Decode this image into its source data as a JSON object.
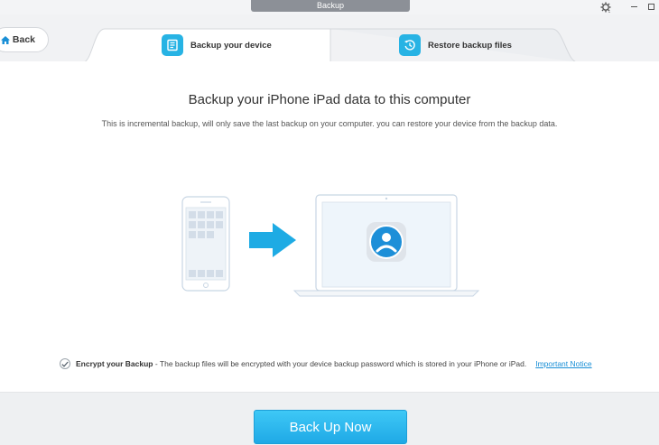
{
  "window": {
    "title": "Backup"
  },
  "nav": {
    "back_label": "Back"
  },
  "tabs": [
    {
      "label": "Backup your device",
      "active": true,
      "icon": "backup-doc-icon"
    },
    {
      "label": "Restore backup files",
      "active": false,
      "icon": "restore-clock-icon"
    }
  ],
  "main": {
    "heading": "Backup your iPhone iPad data to this computer",
    "subtext": "This is incremental backup, will only save the last backup on your computer. you can restore your device from the backup data."
  },
  "encrypt": {
    "checked": true,
    "title": "Encrypt your Backup",
    "description": " - The backup files will be encrypted with your device backup password which is stored in your iPhone or iPad.",
    "link_label": "Important Notice"
  },
  "footer": {
    "primary_label": "Back Up Now"
  },
  "colors": {
    "accent": "#27b3e4",
    "button": "#2bb7ef",
    "link": "#1a8fd6"
  }
}
